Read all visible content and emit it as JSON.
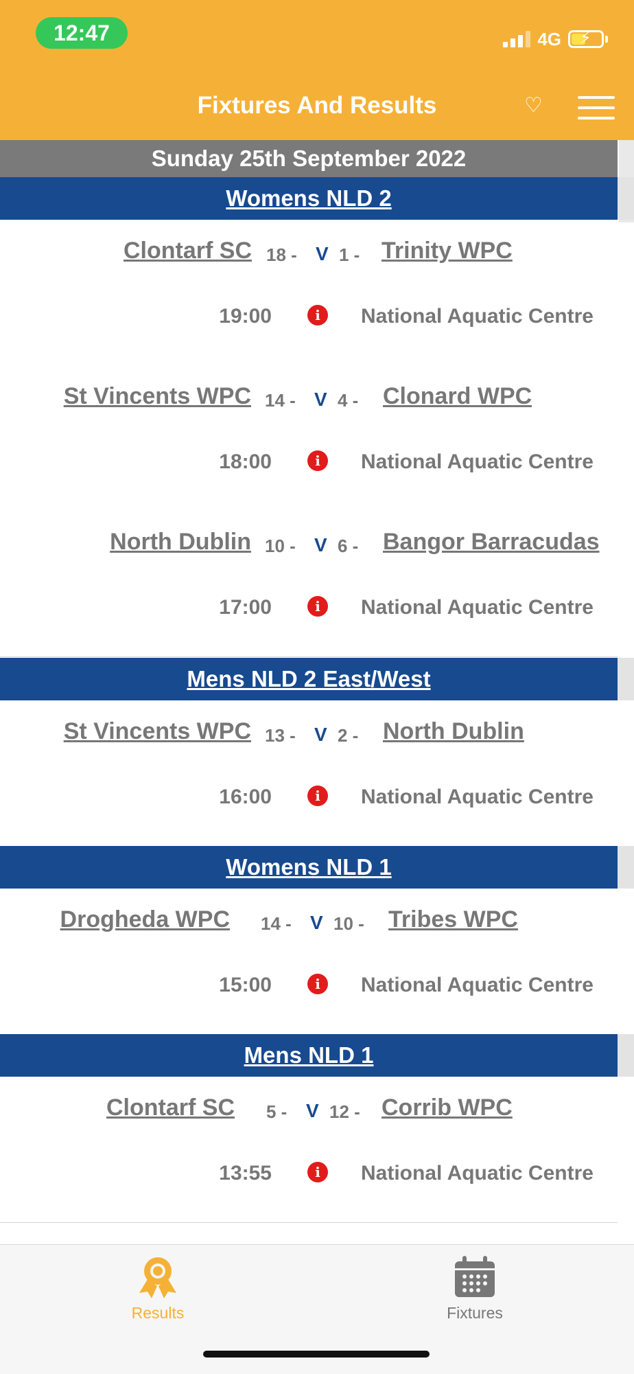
{
  "status": {
    "time": "12:47",
    "network": "4G"
  },
  "header": {
    "title": "Fixtures And Results"
  },
  "date": "Sunday 25th September 2022",
  "sections": [
    {
      "title": "Womens NLD 2"
    },
    {
      "title": "Mens NLD 2 East/West"
    },
    {
      "title": "Womens NLD 1"
    },
    {
      "title": "Mens NLD 1"
    }
  ],
  "matches": [
    {
      "home": "Clontarf SC",
      "home_score": "18 -",
      "vs": "V",
      "away_score": "1 -",
      "away": "Trinity WPC",
      "time": "19:00",
      "info": "i",
      "venue": "National Aquatic Centre"
    },
    {
      "home": "St Vincents WPC",
      "home_score": "14 -",
      "vs": "V",
      "away_score": "4 -",
      "away": "Clonard WPC",
      "time": "18:00",
      "info": "i",
      "venue": "National Aquatic Centre"
    },
    {
      "home": "North Dublin",
      "home_score": "10 -",
      "vs": "V",
      "away_score": "6 -",
      "away": "Bangor Barracudas",
      "time": "17:00",
      "info": "i",
      "venue": "National Aquatic Centre"
    },
    {
      "home": "St Vincents WPC",
      "home_score": "13 -",
      "vs": "V",
      "away_score": "2 -",
      "away": "North Dublin",
      "time": "16:00",
      "info": "i",
      "venue": "National Aquatic Centre"
    },
    {
      "home": "Drogheda WPC",
      "home_score": "14 -",
      "vs": "V",
      "away_score": "10 -",
      "away": "Tribes WPC",
      "time": "15:00",
      "info": "i",
      "venue": "National Aquatic Centre"
    },
    {
      "home": "Clontarf SC",
      "home_score": "5 -",
      "vs": "V",
      "away_score": "12 -",
      "away": "Corrib WPC",
      "time": "13:55",
      "info": "i",
      "venue": "National Aquatic Centre"
    }
  ],
  "tabs": [
    {
      "label": "Results",
      "icon": "award-ribbon-icon",
      "active": true
    },
    {
      "label": "Fixtures",
      "icon": "calendar-icon",
      "active": false
    }
  ],
  "colors": {
    "accent": "#f5b137",
    "section": "#174a8f",
    "info": "#e21b1b",
    "text_muted": "#777777"
  }
}
